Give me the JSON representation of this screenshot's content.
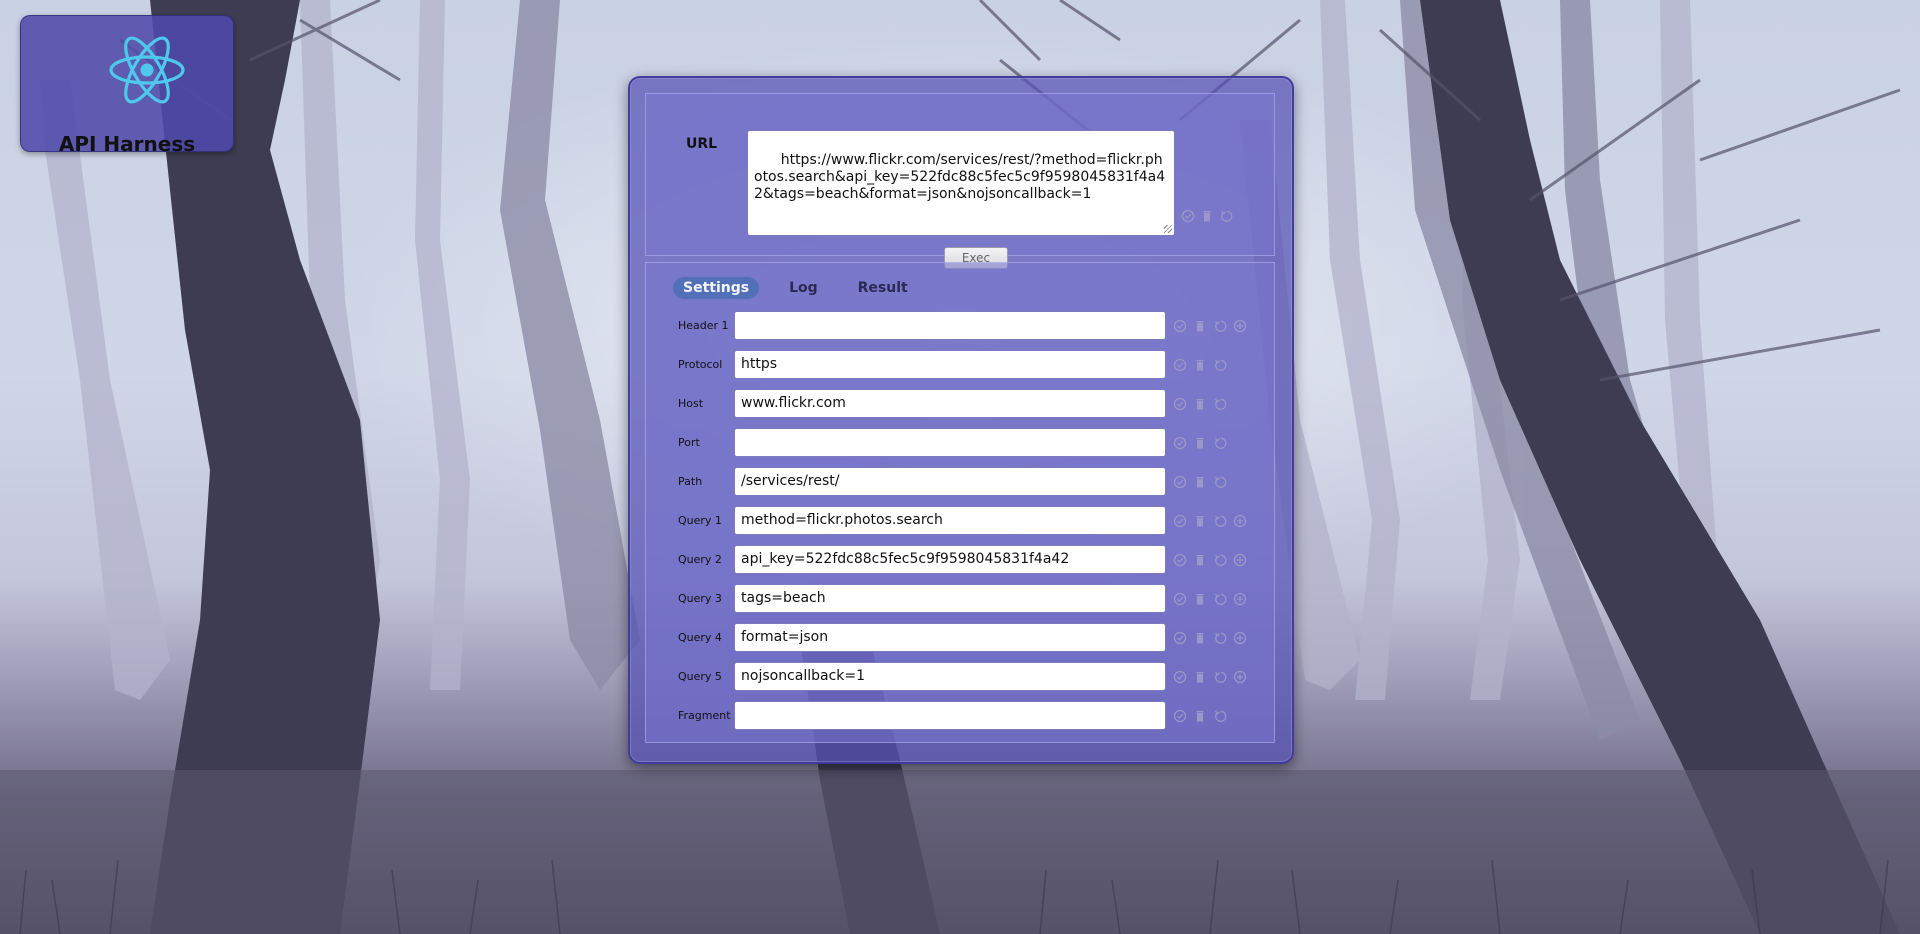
{
  "app": {
    "title": "API Harness",
    "logo_icon": "atom-icon",
    "accent": "#5270b8",
    "panel_color": "#5450b4"
  },
  "request": {
    "url_label": "URL",
    "url_value": "https://www.flickr.com/services/rest/?method=flickr.photos.search&api_key=522fdc88c5fec5c9f9598045831f4a42&tags=beach&format=json&nojsoncallback=1",
    "exec_label": "Exec"
  },
  "tabs": [
    {
      "label": "Settings",
      "active": true
    },
    {
      "label": "Log",
      "active": false
    },
    {
      "label": "Result",
      "active": false
    }
  ],
  "fields": [
    {
      "label": "Header 1",
      "value": "",
      "has_add": true
    },
    {
      "label": "Protocol",
      "value": "https",
      "has_add": false
    },
    {
      "label": "Host",
      "value": "www.flickr.com",
      "has_add": false
    },
    {
      "label": "Port",
      "value": "",
      "has_add": false
    },
    {
      "label": "Path",
      "value": "/services/rest/",
      "has_add": false
    },
    {
      "label": "Query 1",
      "value": "method=flickr.photos.search",
      "has_add": true
    },
    {
      "label": "Query 2",
      "value": "api_key=522fdc88c5fec5c9f9598045831f4a42",
      "has_add": true
    },
    {
      "label": "Query 3",
      "value": "tags=beach",
      "has_add": true
    },
    {
      "label": "Query 4",
      "value": "format=json",
      "has_add": true
    },
    {
      "label": "Query 5",
      "value": "nojsoncallback=1",
      "has_add": true
    },
    {
      "label": "Fragment",
      "value": "",
      "has_add": false
    }
  ],
  "row_icons": [
    "check-circle-icon",
    "trash-icon",
    "undo-icon",
    "plus-circle-icon"
  ]
}
